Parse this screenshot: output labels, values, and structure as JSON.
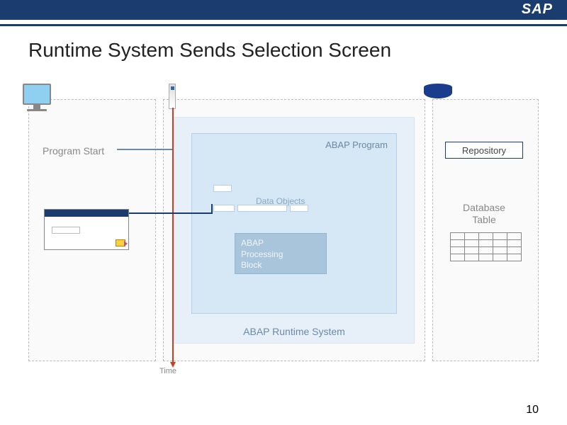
{
  "header": {
    "logo": "SAP"
  },
  "title": "Runtime System Sends Selection Screen",
  "left_panel": {
    "program_start": "Program Start"
  },
  "runtime": {
    "outer_label": "ABAP Runtime System",
    "program_label": "ABAP Program",
    "data_objects_label": "Data Objects",
    "processing_block": "ABAP\nProcessing\nBlock"
  },
  "right_panel": {
    "repository": "Repository",
    "database_table": "Database\nTable"
  },
  "timeline_label": "Time",
  "page_number": "10"
}
